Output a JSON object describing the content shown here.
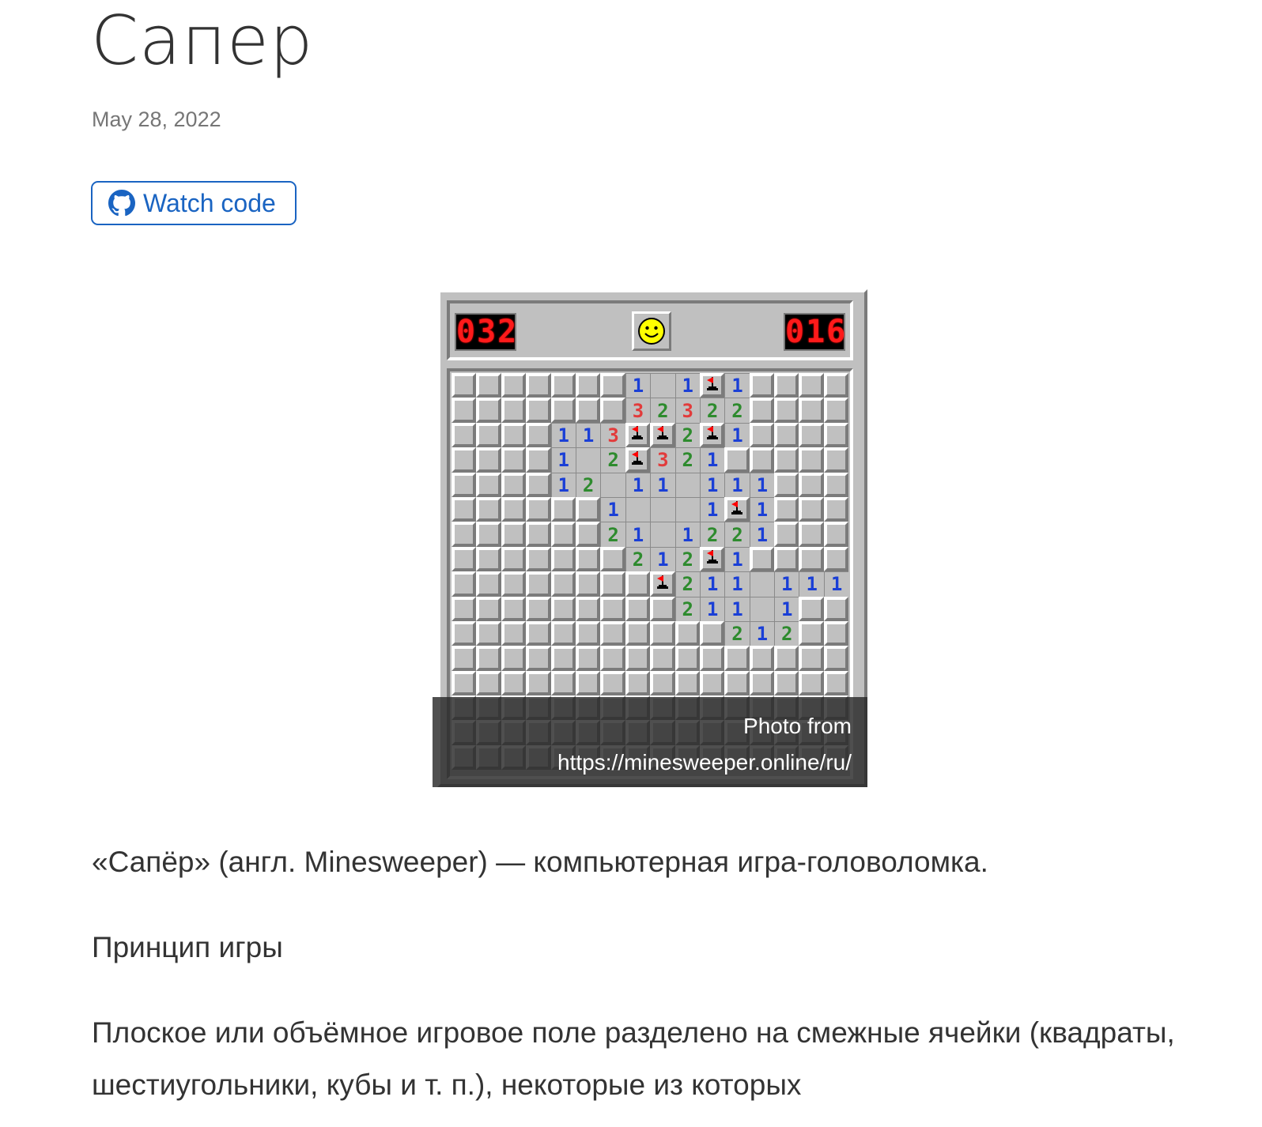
{
  "page": {
    "title": "Сапер",
    "date": "May 28, 2022",
    "watch_code_label": "Watch code"
  },
  "game": {
    "mine_counter": "032",
    "timer": "016",
    "face": "smiley",
    "board": [
      "#######1.1F1####",
      "#######32322####",
      "####113FF2F1####",
      "####1.2F321#####",
      "####12.11.111###",
      "######1...1F1###",
      "######21.1221###",
      "#######212F1####",
      "########F211.111",
      "#########211.1##",
      "###########212##",
      "################",
      "################",
      "################",
      "################",
      "################"
    ],
    "colors": {
      "one": "#1a3fd6",
      "two": "#2e8b2e",
      "three": "#e23b3b",
      "counter": "#ff1a1a"
    },
    "caption_line1": "Photo from",
    "caption_line2": "https://minesweeper.online/ru/"
  },
  "content": {
    "intro": "«Сапёр» (англ. Minesweeper) — компьютерная игра-головоломка.",
    "section_title": "Принцип игры",
    "paragraph": "Плоское или объёмное игровое поле разделено на смежные ячейки (квадраты, шестиугольники, кубы и т. п.), некоторые из которых"
  },
  "icons": {
    "github": "github-icon",
    "flag": "flag-icon",
    "smiley": "smiley-face-icon"
  }
}
